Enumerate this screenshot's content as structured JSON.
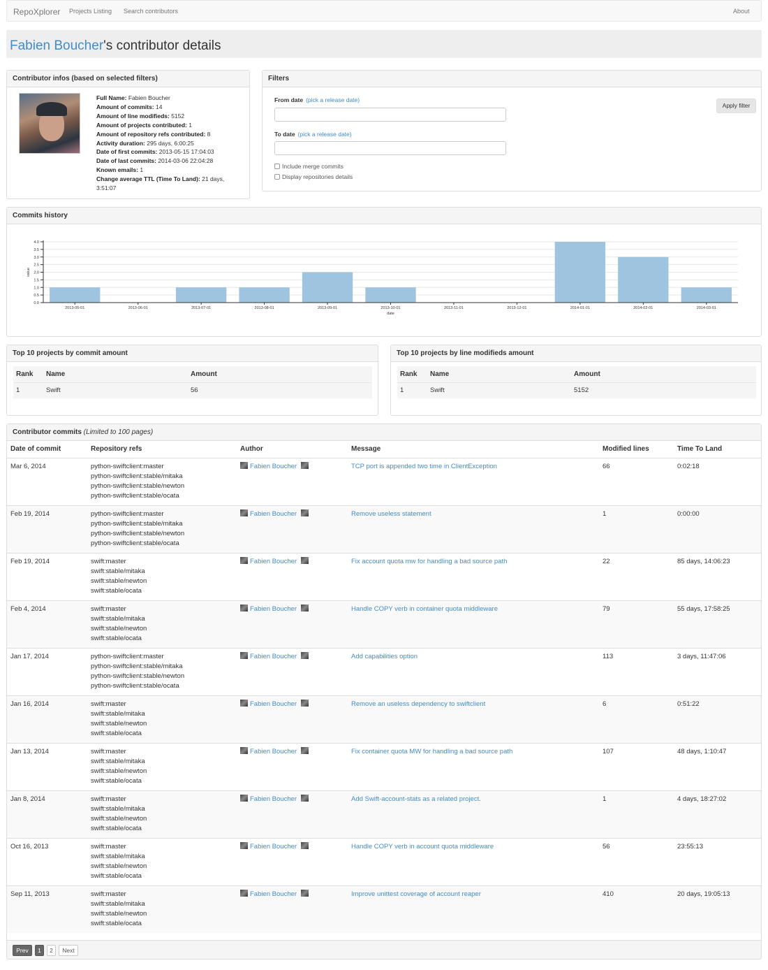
{
  "navbar": {
    "brand": "RepoXplorer",
    "links": [
      "Projects Listing",
      "Search contributors"
    ],
    "about": "About"
  },
  "header": {
    "name": "Fabien Boucher",
    "suffix": "'s contributor details"
  },
  "contributor_infos": {
    "title": "Contributor infos (based on selected filters)",
    "lines": [
      {
        "label": "Full Name:",
        "value": " Fabien Boucher"
      },
      {
        "label": "Amount of commits:",
        "value": " 14"
      },
      {
        "label": "Amount of line modifieds:",
        "value": " 5152"
      },
      {
        "label": "Amount of projects contributed:",
        "value": " 1"
      },
      {
        "label": "Amount of repository refs contributed:",
        "value": " 8"
      },
      {
        "label": "Activity duration:",
        "value": " 295 days, 6:00:25"
      },
      {
        "label": "Date of first commits:",
        "value": " 2013-05-15 17:04:03"
      },
      {
        "label": "Date of last commits:",
        "value": " 2014-03-06 22:04:28"
      },
      {
        "label": "Known emails:",
        "value": " 1"
      },
      {
        "label": "Change average TTL (Time To Land):",
        "value": " 21 days, 3:51:07"
      }
    ]
  },
  "filters": {
    "title": "Filters",
    "from_label": "From date",
    "to_label": "To date",
    "pick_link": "(pick a release date)",
    "include_merge": "Include merge commits",
    "display_repos": "Display repositories details",
    "apply_button": "Apply filter"
  },
  "commits_history": {
    "title": "Commits history"
  },
  "chart_data": {
    "type": "bar",
    "categories": [
      "2013-05-01",
      "2013-06-01",
      "2013-07-01",
      "2013-08-01",
      "2013-09-01",
      "2013-10-01",
      "2013-11-01",
      "2013-12-01",
      "2014-01-01",
      "2014-02-01",
      "2014-03-01"
    ],
    "values": [
      1,
      0,
      1,
      1,
      2,
      1,
      0,
      0,
      4,
      3,
      1
    ],
    "xlabel": "date",
    "ylabel": "value",
    "ylim": [
      0,
      4
    ],
    "yticks": [
      "0.0",
      "0.5",
      "1.0",
      "1.5",
      "2.0",
      "2.5",
      "3.0",
      "3.5",
      "4.0"
    ],
    "bar_color": "#9ec4df",
    "grid": true
  },
  "top_commits": {
    "title": "Top 10 projects by commit amount",
    "headers": [
      "Rank",
      "Name",
      "Amount"
    ],
    "rows": [
      [
        "1",
        "Swift",
        "56"
      ]
    ]
  },
  "top_lines": {
    "title": "Top 10 projects by line modifieds amount",
    "headers": [
      "Rank",
      "Name",
      "Amount"
    ],
    "rows": [
      [
        "1",
        "Swift",
        "5152"
      ]
    ]
  },
  "commits": {
    "title": "Contributor commits",
    "subtitle": "(Limited to 100 pages)",
    "headers": [
      "Date of commit",
      "Repository refs",
      "Author",
      "Message",
      "Modified lines",
      "Time To Land"
    ],
    "author": "Fabien Boucher",
    "rows": [
      {
        "date": "Mar 6, 2014",
        "refs": [
          "python-swiftclient:master",
          "python-swiftclient:stable/mitaka",
          "python-swiftclient:stable/newton",
          "python-swiftclient:stable/ocata"
        ],
        "message": "TCP port is appended two time in ClientException",
        "lines": "66",
        "ttl": "0:02:18"
      },
      {
        "date": "Feb 19, 2014",
        "refs": [
          "python-swiftclient:master",
          "python-swiftclient:stable/mitaka",
          "python-swiftclient:stable/newton",
          "python-swiftclient:stable/ocata"
        ],
        "message": "Remove useless statement",
        "lines": "1",
        "ttl": "0:00:00"
      },
      {
        "date": "Feb 19, 2014",
        "refs": [
          "swift:master",
          "swift:stable/mitaka",
          "swift:stable/newton",
          "swift:stable/ocata"
        ],
        "message": "Fix account quota mw for handling a bad source path",
        "lines": "22",
        "ttl": "85 days, 14:06:23"
      },
      {
        "date": "Feb 4, 2014",
        "refs": [
          "swift:master",
          "swift:stable/mitaka",
          "swift:stable/newton",
          "swift:stable/ocata"
        ],
        "message": "Handle COPY verb in container quota middleware",
        "lines": "79",
        "ttl": "55 days, 17:58:25"
      },
      {
        "date": "Jan 17, 2014",
        "refs": [
          "python-swiftclient:master",
          "python-swiftclient:stable/mitaka",
          "python-swiftclient:stable/newton",
          "python-swiftclient:stable/ocata"
        ],
        "message": "Add capabilities option",
        "lines": "113",
        "ttl": "3 days, 11:47:06"
      },
      {
        "date": "Jan 16, 2014",
        "refs": [
          "swift:master",
          "swift:stable/mitaka",
          "swift:stable/newton",
          "swift:stable/ocata"
        ],
        "message": "Remove an useless dependency to swiftclient",
        "lines": "6",
        "ttl": "0:51:22"
      },
      {
        "date": "Jan 13, 2014",
        "refs": [
          "swift:master",
          "swift:stable/mitaka",
          "swift:stable/newton",
          "swift:stable/ocata"
        ],
        "message": "Fix container quota MW for handling a bad source path",
        "lines": "107",
        "ttl": "48 days, 1:10:47"
      },
      {
        "date": "Jan 8, 2014",
        "refs": [
          "swift:master",
          "swift:stable/mitaka",
          "swift:stable/newton",
          "swift:stable/ocata"
        ],
        "message": "Add Swift-account-stats as a related project.",
        "lines": "1",
        "ttl": "4 days, 18:27:02"
      },
      {
        "date": "Oct 16, 2013",
        "refs": [
          "swift:master",
          "swift:stable/mitaka",
          "swift:stable/newton",
          "swift:stable/ocata"
        ],
        "message": "Handle COPY verb in account quota middleware",
        "lines": "56",
        "ttl": "23:55:13"
      },
      {
        "date": "Sep 11, 2013",
        "refs": [
          "swift:master",
          "swift:stable/mitaka",
          "swift:stable/newton",
          "swift:stable/ocata"
        ],
        "message": "Improve unittest coverage of account reaper",
        "lines": "410",
        "ttl": "20 days, 19:05:13"
      }
    ]
  },
  "pagination": {
    "prev": "Prev",
    "pages": [
      "1",
      "2"
    ],
    "next": "Next"
  }
}
